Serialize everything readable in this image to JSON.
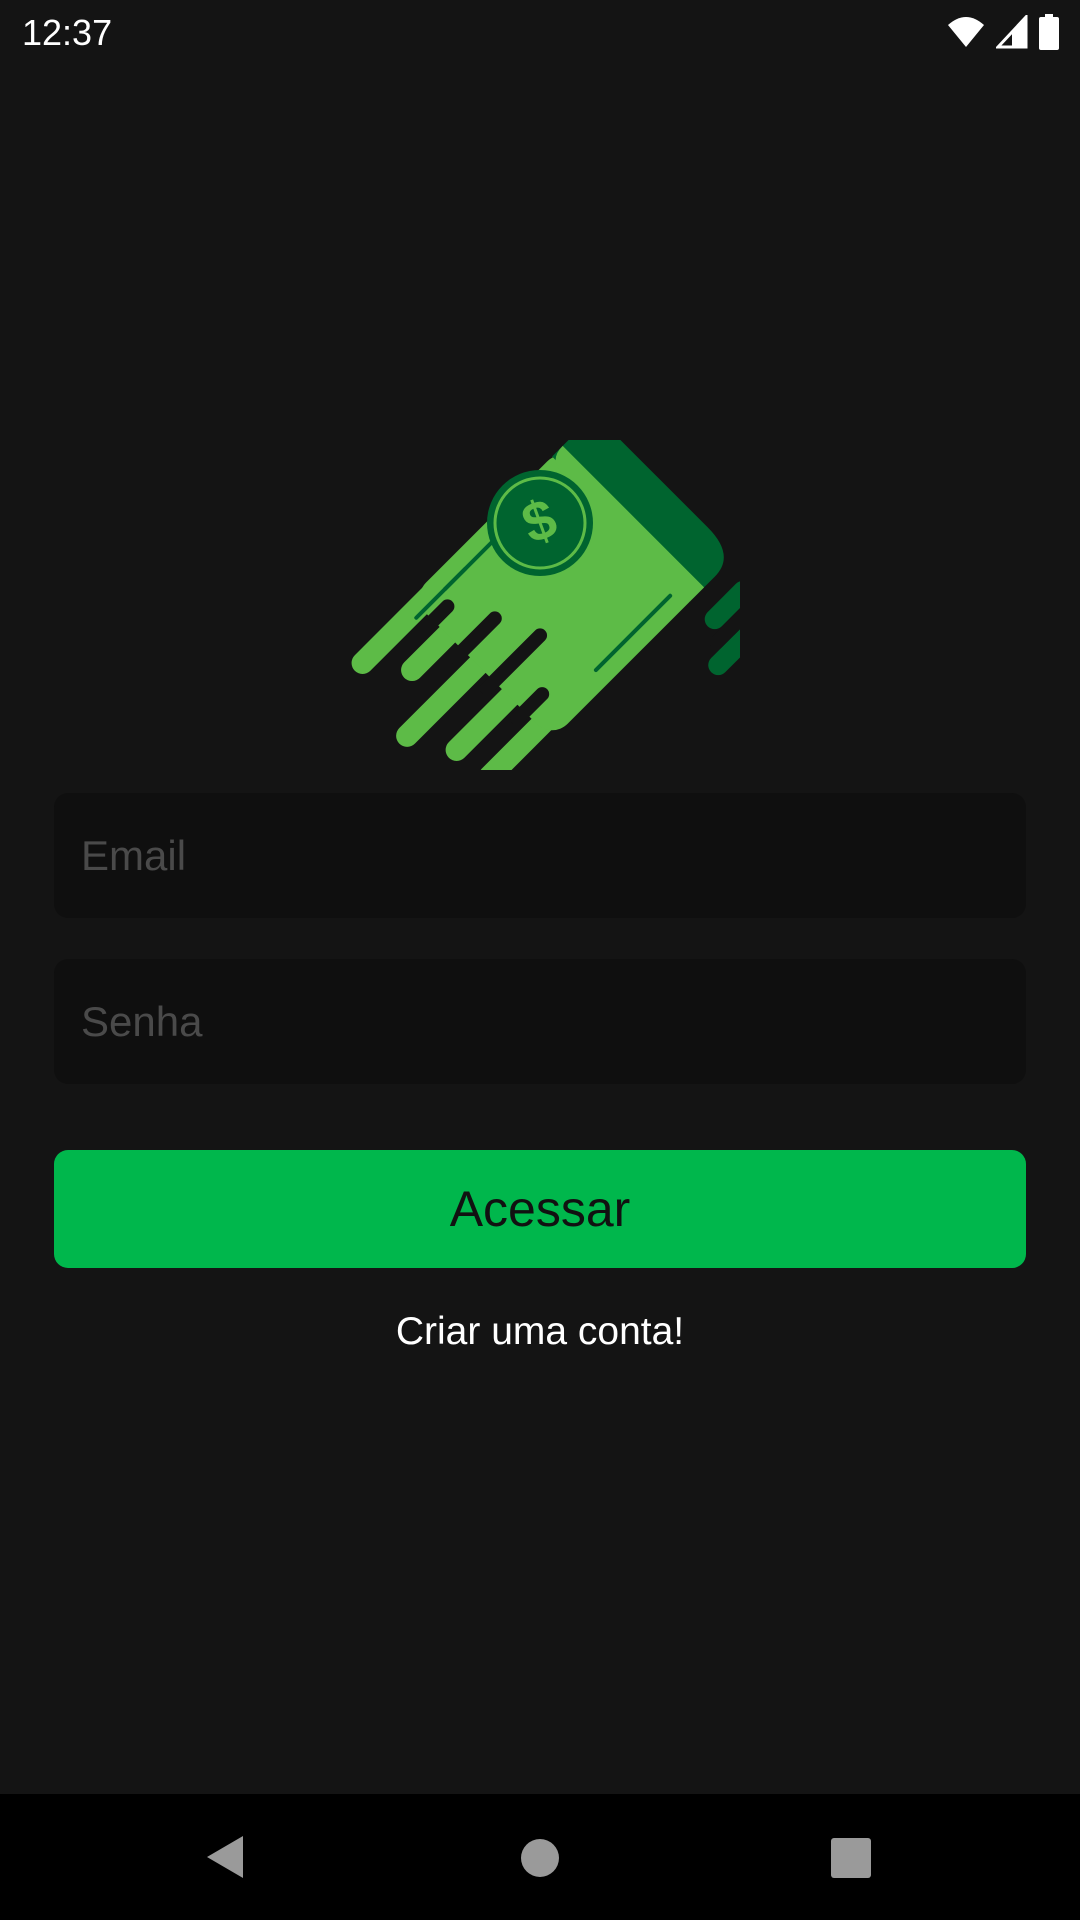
{
  "status_bar": {
    "time": "12:37",
    "icons": [
      "wifi-icon",
      "signal-icon",
      "battery-icon"
    ]
  },
  "logo": {
    "icon": "flying-money-icon",
    "symbol": "$",
    "colors": {
      "light": "#5dbb47",
      "dark": "#00642f"
    }
  },
  "form": {
    "email_placeholder": "Email",
    "email_value": "",
    "password_placeholder": "Senha",
    "password_value": "",
    "submit_label": "Acessar",
    "create_account_label": "Criar uma conta!"
  },
  "colors": {
    "accent": "#00b74c",
    "background": "#141414",
    "field": "#0f0f0f"
  },
  "nav_bar": {
    "icons": [
      "back-icon",
      "home-icon",
      "recents-icon"
    ]
  }
}
